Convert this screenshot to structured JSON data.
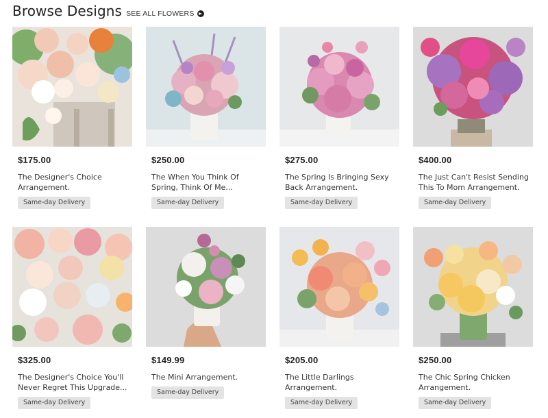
{
  "header": {
    "title": "Browse Designs",
    "see_all": "SEE ALL FLOWERS"
  },
  "products": [
    {
      "price": "$175.00",
      "name": "The Designer's Choice Arrangement.",
      "badge": "Same-day Delivery"
    },
    {
      "price": "$250.00",
      "name": "The When You Think Of Spring, Think Of Me...",
      "badge": "Same-day Delivery"
    },
    {
      "price": "$275.00",
      "name": "The Spring Is Bringing Sexy Back Arrangement.",
      "badge": "Same-day Delivery"
    },
    {
      "price": "$400.00",
      "name": "The Just Can't Resist Sending This To Mom Arrangement.",
      "badge": "Same-day Delivery"
    },
    {
      "price": "$325.00",
      "name": "The Designer's Choice You'll Never Regret This Upgrade...",
      "badge": "Same-day Delivery"
    },
    {
      "price": "$149.99",
      "name": "The Mini Arrangement.",
      "badge": "Same-day Delivery"
    },
    {
      "price": "$205.00",
      "name": "The Little Darlings Arrangement.",
      "badge": "Same-day Delivery"
    },
    {
      "price": "$250.00",
      "name": "The Chic Spring Chicken Arrangement.",
      "badge": "Same-day Delivery"
    }
  ]
}
